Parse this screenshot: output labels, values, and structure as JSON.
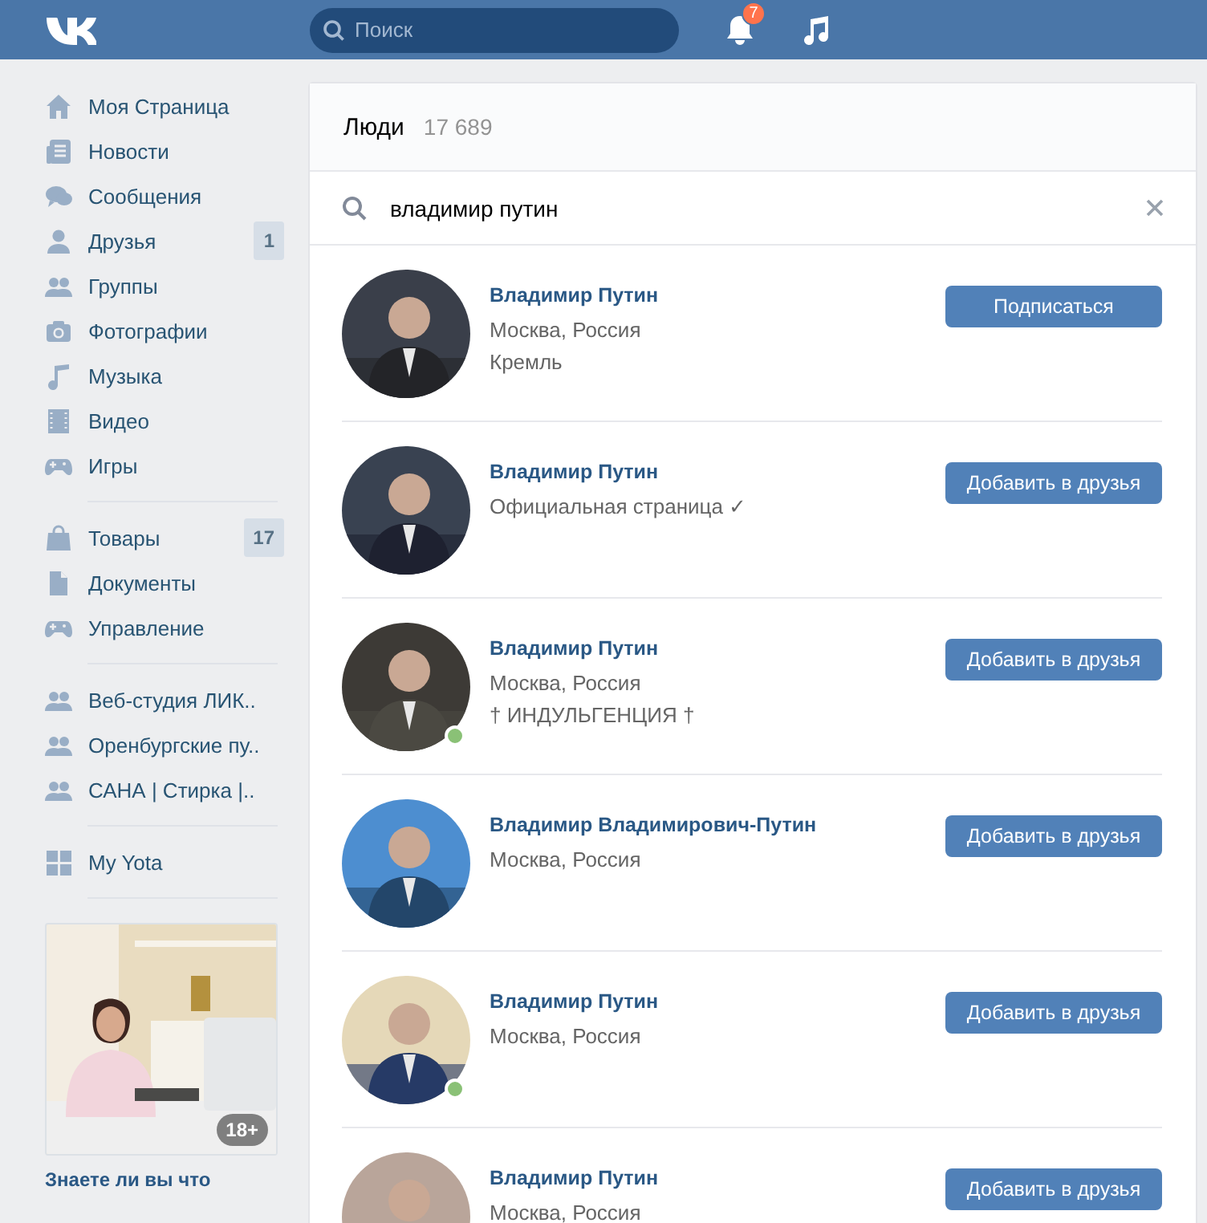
{
  "header": {
    "search": {
      "placeholder": "Поиск"
    },
    "notifications": {
      "badge": "7"
    }
  },
  "sidebar": {
    "groups": [
      [
        {
          "label": "Моя Страница"
        },
        {
          "label": "Новости"
        },
        {
          "label": "Сообщения"
        },
        {
          "label": "Друзья",
          "badge": "1"
        },
        {
          "label": "Группы"
        },
        {
          "label": "Фотографии"
        },
        {
          "label": "Музыка"
        },
        {
          "label": "Видео"
        },
        {
          "label": "Игры"
        }
      ],
      [
        {
          "label": "Товары",
          "badge": "17"
        },
        {
          "label": "Документы"
        },
        {
          "label": "Управление"
        }
      ],
      [
        {
          "label": "Веб-студия ЛИК.."
        },
        {
          "label": "Оренбургские пу.."
        },
        {
          "label": "САНА | Стирка |.."
        }
      ],
      [
        {
          "label": "My Yota"
        }
      ]
    ],
    "ad": {
      "age": "18+",
      "title": "Знаете ли вы что"
    }
  },
  "people": {
    "title": "Люди",
    "count": "17 689",
    "query": "владимир путин",
    "results": [
      {
        "name": "Владимир Путин",
        "lines": [
          "Москва, Россия",
          "Кремль"
        ],
        "button": "Подписаться",
        "online": false
      },
      {
        "name": "Владимир Путин",
        "lines": [
          "Официальная страница ✓"
        ],
        "button": "Добавить в друзья",
        "online": false
      },
      {
        "name": "Владимир Путин",
        "lines": [
          "Москва, Россия",
          "† ИНДУЛЬГЕНЦИЯ †"
        ],
        "button": "Добавить в друзья",
        "online": true
      },
      {
        "name": "Владимир Владимирович-Путин",
        "lines": [
          "Москва, Россия"
        ],
        "button": "Добавить в друзья",
        "online": false
      },
      {
        "name": "Владимир Путин",
        "lines": [
          "Москва, Россия"
        ],
        "button": "Добавить в друзья",
        "online": true
      },
      {
        "name": "Владимир Путин",
        "lines": [
          "Москва, Россия"
        ],
        "button": "Добавить в друзья",
        "online": false
      }
    ]
  }
}
